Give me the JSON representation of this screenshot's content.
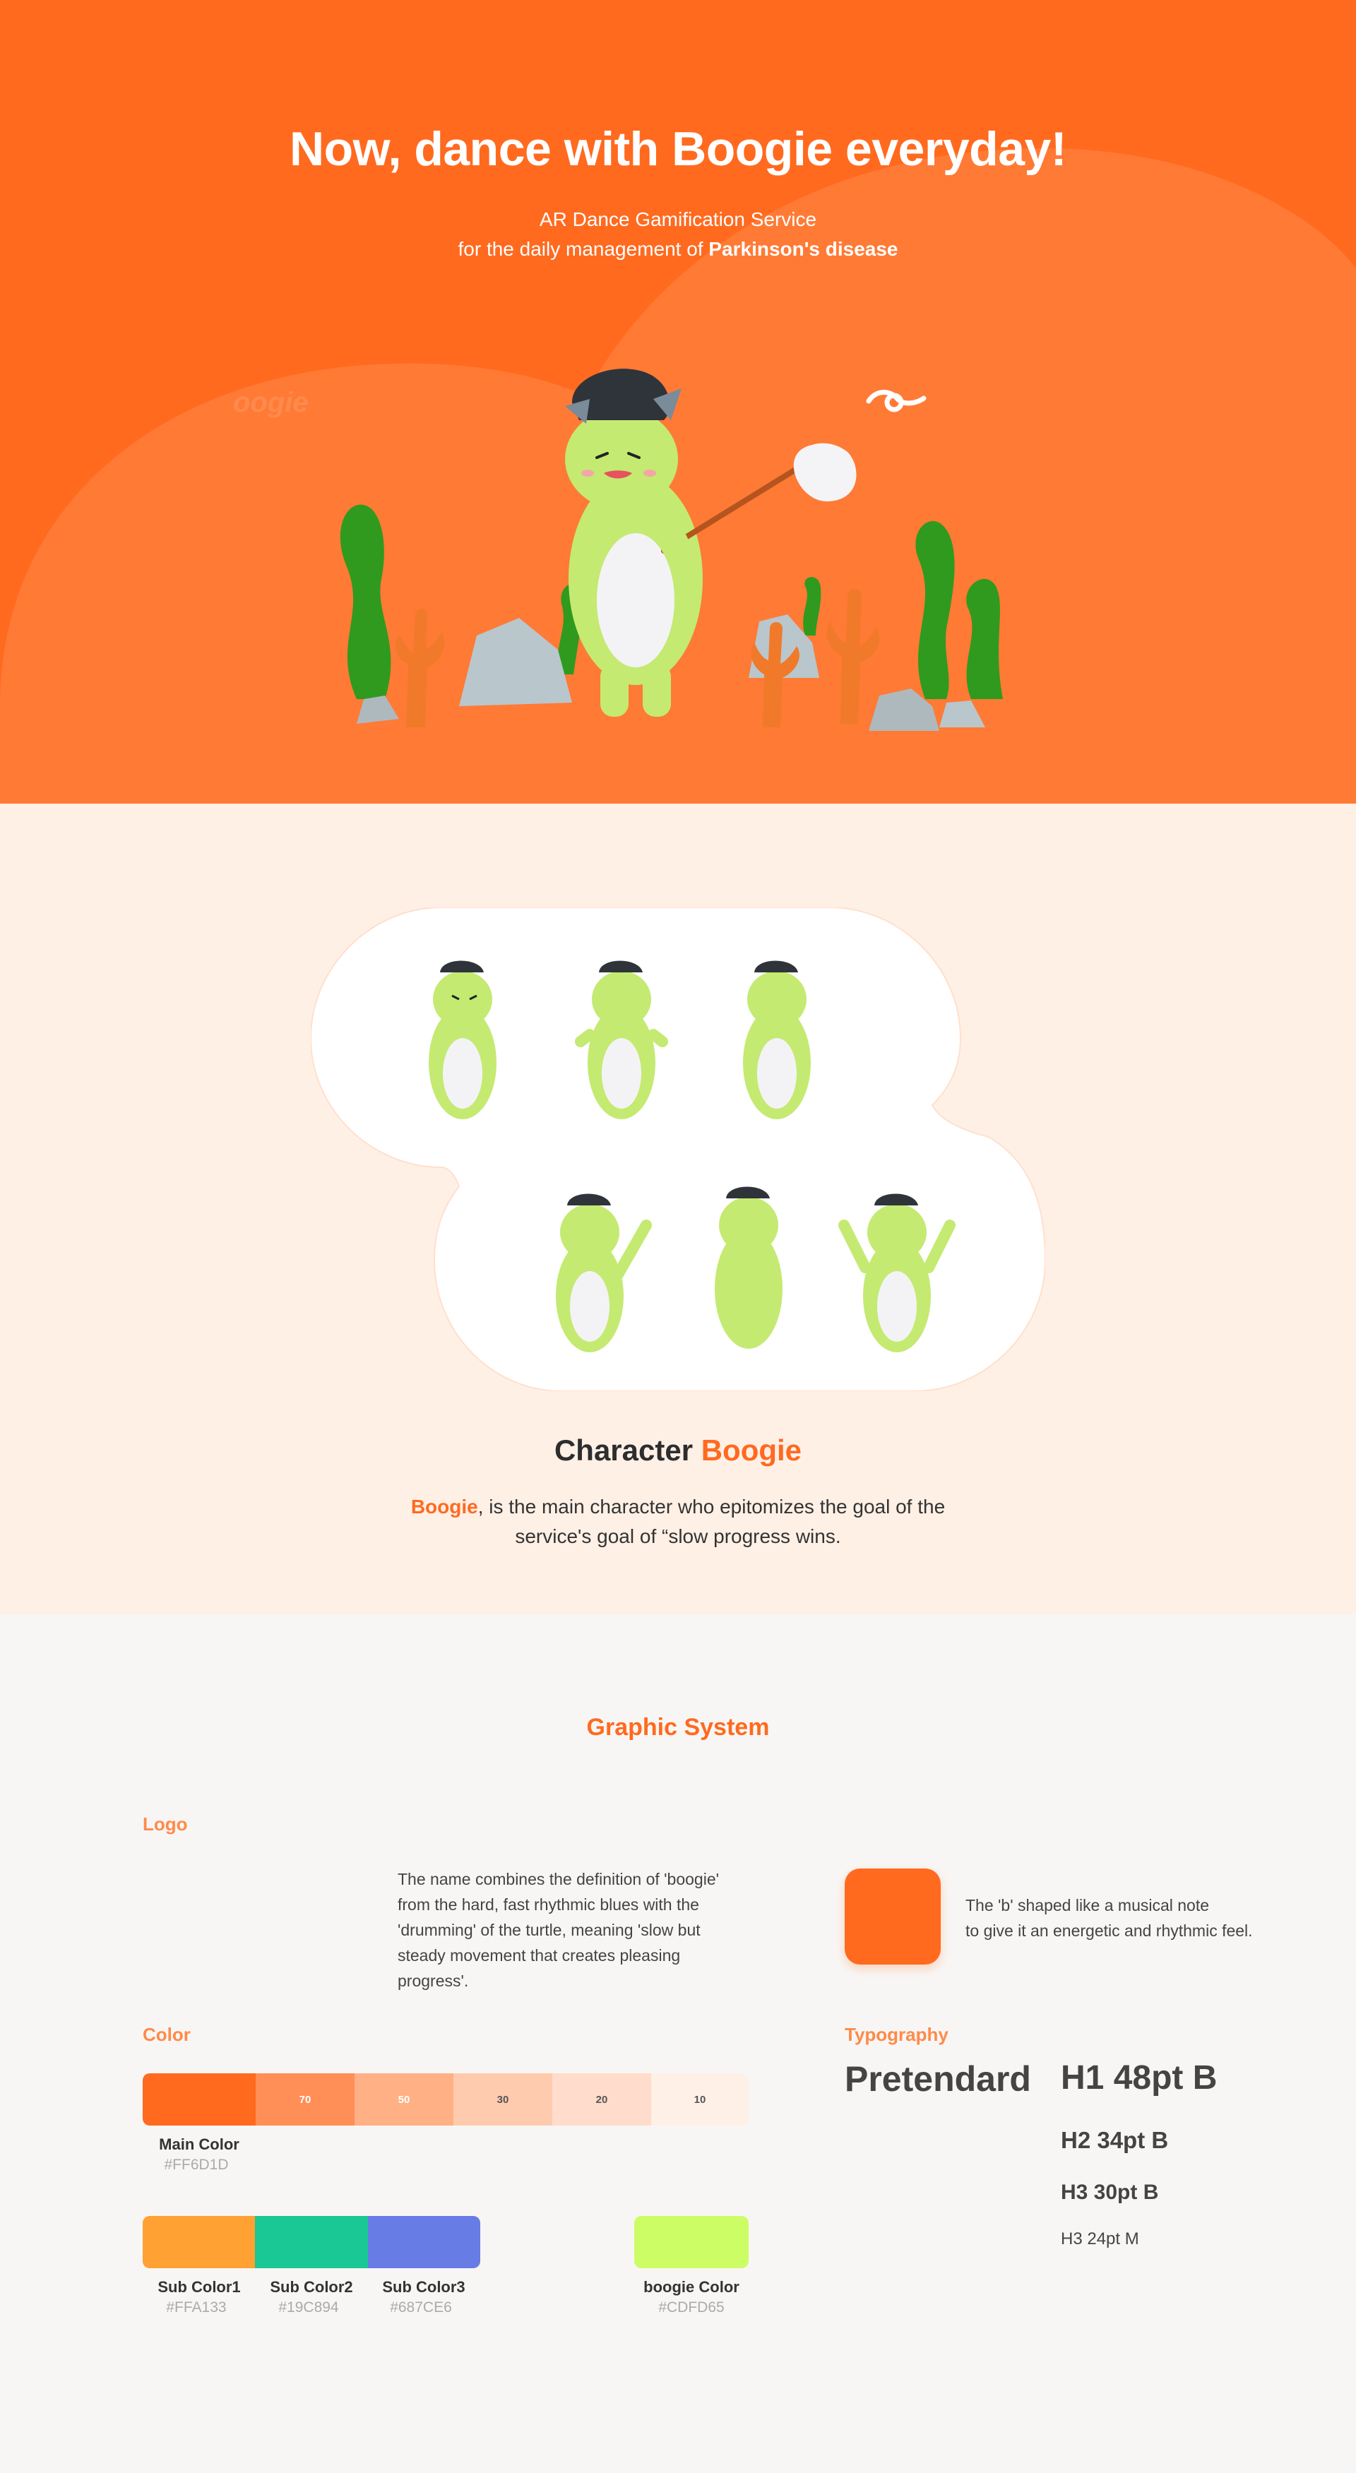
{
  "hero": {
    "title": "Now, dance with Boogie everyday!",
    "subtitle_line1": "AR Dance Gamification Service",
    "subtitle_line2_prefix": "for the daily management of ",
    "subtitle_line2_bold": "Parkinson's disease",
    "watermark": "oogie",
    "colors": {
      "background": "#ff6a1f",
      "blob": "#ff7a35"
    }
  },
  "character": {
    "title_prefix": "Character ",
    "title_accent": "Boogie",
    "desc_accent": "Boogie",
    "desc_rest": ", is the main character who epitomizes the goal of the service's goal of “slow progress wins.",
    "poses": [
      "boogie-grumpy",
      "boogie-happy",
      "boogie-thinking",
      "boogie-pointing",
      "boogie-walking",
      "boogie-cheering"
    ]
  },
  "graphic_system": {
    "title": "Graphic System",
    "logo": {
      "label": "Logo",
      "description": "The name combines the definition of 'boogie' from the hard, fast rhythmic blues with the 'drumming' of the turtle, meaning 'slow but steady movement that creates pleasing progress'.",
      "icon_description_line1": "The 'b' shaped like a musical note",
      "icon_description_line2": "to give it an energetic and rhythmic feel."
    },
    "color": {
      "label": "Color",
      "main_tints": [
        "",
        "70",
        "50",
        "30",
        "20",
        "10"
      ],
      "main_tint_colors": [
        "#ff6a1f",
        "#ff8f57",
        "#ffb085",
        "#ffcbae",
        "#ffdccb",
        "#fff0e7"
      ],
      "main": {
        "name": "Main Color",
        "hex": "#FF6D1D"
      },
      "subs": [
        {
          "name": "Sub Color1",
          "hex": "#FFA133"
        },
        {
          "name": "Sub Color2",
          "hex": "#19C894"
        },
        {
          "name": "Sub Color3",
          "hex": "#687CE6"
        }
      ],
      "boogie": {
        "name": "boogie Color",
        "hex": "#CDFD65"
      }
    },
    "typography": {
      "label": "Typography",
      "font_name": "Pretendard",
      "h1": "H1 48pt B",
      "h2": "H2 34pt B",
      "h3b": "H3 30pt B",
      "h3m": "H3 24pt M"
    }
  }
}
